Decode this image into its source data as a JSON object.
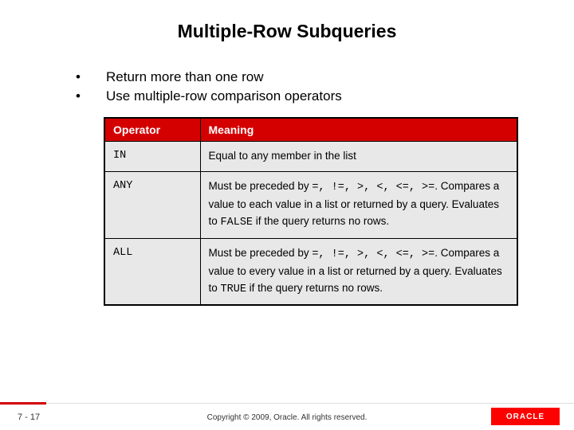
{
  "title": "Multiple-Row Subqueries",
  "bullets": [
    "Return more than one row",
    "Use multiple-row comparison operators"
  ],
  "table": {
    "headers": {
      "op": "Operator",
      "meaning": "Meaning"
    },
    "rows": [
      {
        "op": "IN",
        "meaning_pre": "Equal to any member in the list",
        "ops_list": "",
        "meaning_mid": "",
        "eval_word": "",
        "meaning_post": ""
      },
      {
        "op": "ANY",
        "meaning_pre": "Must be preceded by ",
        "ops_list": "=, !=, >, <, <=, >=",
        "meaning_mid": ". Compares a value to each value in a list or returned by a query. Evaluates to ",
        "eval_word": "FALSE",
        "meaning_post": " if the query returns no rows."
      },
      {
        "op": "ALL",
        "meaning_pre": "Must be preceded by ",
        "ops_list": "=, !=, >, <, <=, >=",
        "meaning_mid": ". Compares a value to every value in a list or returned by a query. Evaluates to ",
        "eval_word": "TRUE",
        "meaning_post": " if the query returns no rows."
      }
    ]
  },
  "footer": {
    "page": "7 - 17",
    "copyright": "Copyright © 2009, Oracle. All rights reserved.",
    "logo": "ORACLE"
  }
}
